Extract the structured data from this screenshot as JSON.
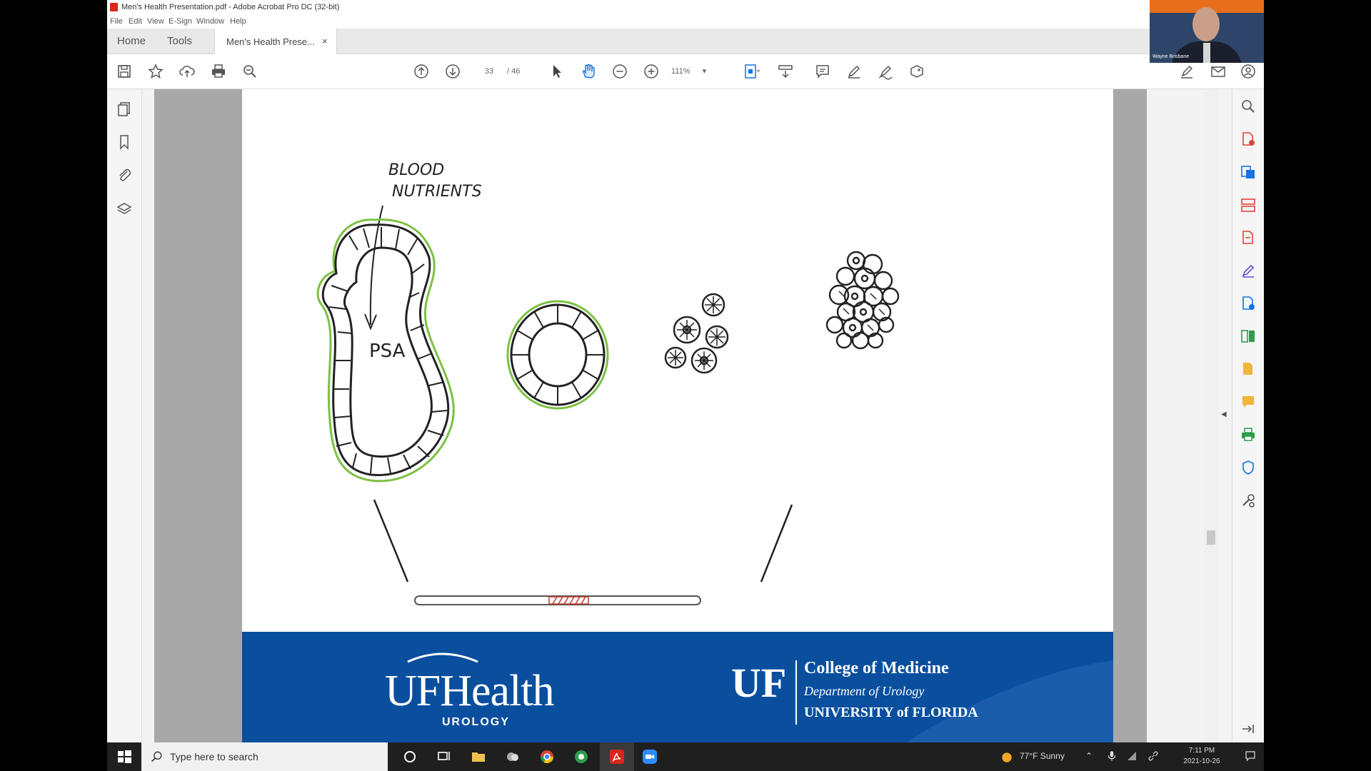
{
  "window": {
    "title": "Men's Health Presentation.pdf - Adobe Acrobat Pro DC (32-bit)",
    "menu": [
      "File",
      "Edit",
      "View",
      "E-Sign",
      "Window",
      "Help"
    ]
  },
  "tabs": {
    "home": "Home",
    "tools": "Tools",
    "document": "Men's Health Prese...",
    "close": "×"
  },
  "toolbar": {
    "current_page": "33",
    "total_pages": "/ 46",
    "zoom": "111%"
  },
  "drawing": {
    "annotation_line1": "BLOOD",
    "annotation_line2": "NUTRIENTS",
    "gland_label": "PSA"
  },
  "footer": {
    "uf_health": "UFHealth",
    "uf_health_sub": "UROLOGY",
    "uf_logo": "UF",
    "college": "College of Medicine",
    "department": "Department of Urology",
    "university": "UNIVERSITY of FLORIDA"
  },
  "webcam": {
    "name": "Wayne Brisbane"
  },
  "taskbar": {
    "search_placeholder": "Type here to search",
    "weather": "77°F  Sunny",
    "time": "7:11 PM",
    "date": "2021-10-26"
  },
  "colors": {
    "footer_blue": "#0a4f9e",
    "gland_outline": "#7dc043",
    "acrobat_red": "#d9261c",
    "acrobat_blue": "#1473e6"
  }
}
